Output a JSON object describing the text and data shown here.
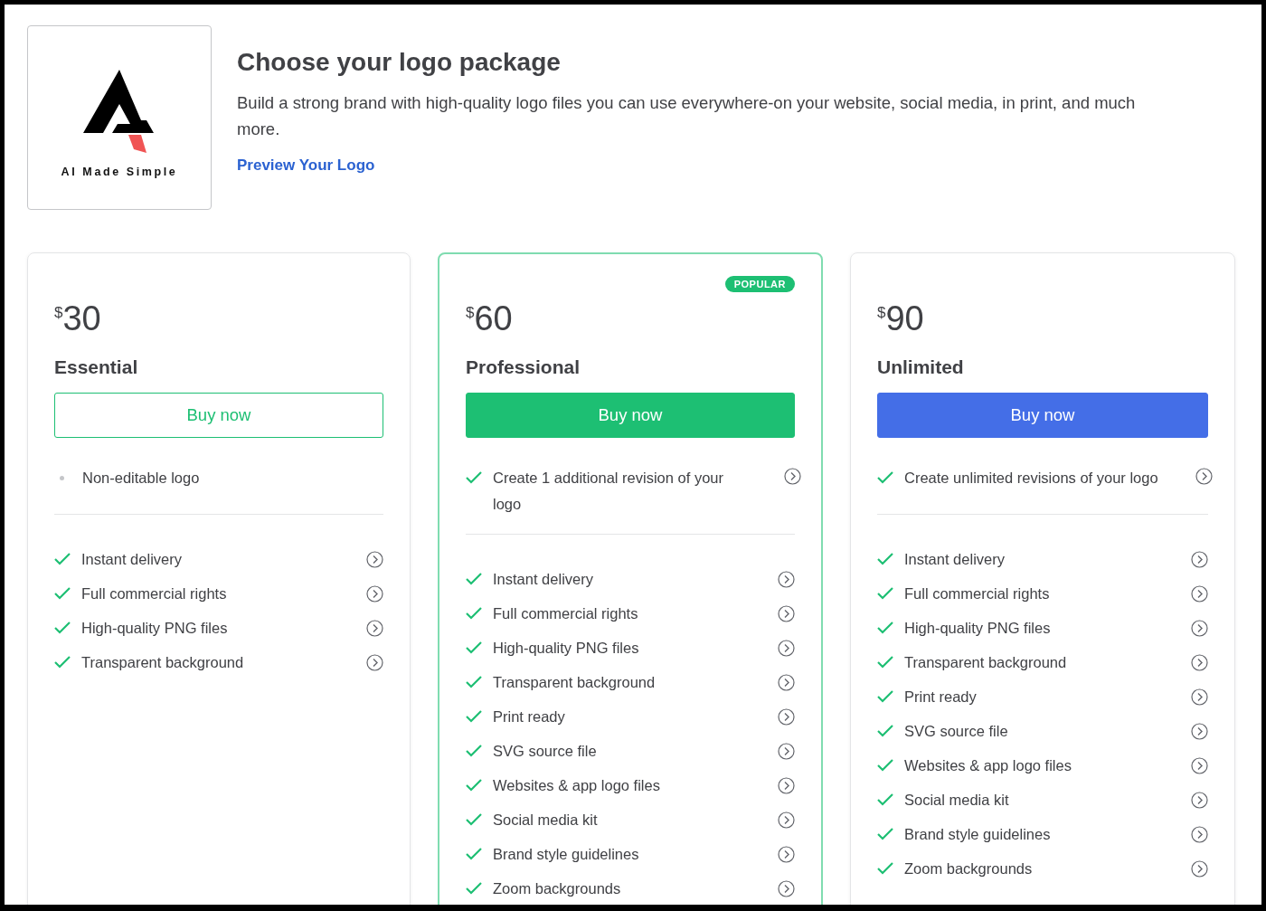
{
  "header": {
    "logo_caption": "AI Made Simple",
    "title": "Choose your logo package",
    "description": "Build a strong brand with high-quality logo files you can use everywhere-on your website, social media, in print, and much more.",
    "link": "Preview Your Logo"
  },
  "plans": [
    {
      "price_symbol": "$",
      "price": "30",
      "name": "Essential",
      "button": {
        "label": "Buy now",
        "kind": "outline"
      },
      "highlighted": false,
      "primary_feature": {
        "kind": "bullet",
        "text": "Non-editable logo"
      },
      "features": [
        "Instant delivery",
        "Full commercial rights",
        "High-quality PNG files",
        "Transparent background"
      ]
    },
    {
      "price_symbol": "$",
      "price": "60",
      "name": "Professional",
      "badge": "POPULAR",
      "button": {
        "label": "Buy now",
        "kind": "green"
      },
      "highlighted": true,
      "primary_feature": {
        "kind": "check",
        "text": "Create 1 additional revision of your logo"
      },
      "features": [
        "Instant delivery",
        "Full commercial rights",
        "High-quality PNG files",
        "Transparent background",
        "Print ready",
        "SVG source file",
        "Websites & app logo files",
        "Social media kit",
        "Brand style guidelines",
        "Zoom backgrounds"
      ]
    },
    {
      "price_symbol": "$",
      "price": "90",
      "name": "Unlimited",
      "button": {
        "label": "Buy now",
        "kind": "blue"
      },
      "highlighted": false,
      "primary_feature": {
        "kind": "check",
        "text": "Create unlimited revisions of your logo"
      },
      "features": [
        "Instant delivery",
        "Full commercial rights",
        "High-quality PNG files",
        "Transparent background",
        "Print ready",
        "SVG source file",
        "Websites & app logo files",
        "Social media kit",
        "Brand style guidelines",
        "Zoom backgrounds"
      ]
    }
  ]
}
